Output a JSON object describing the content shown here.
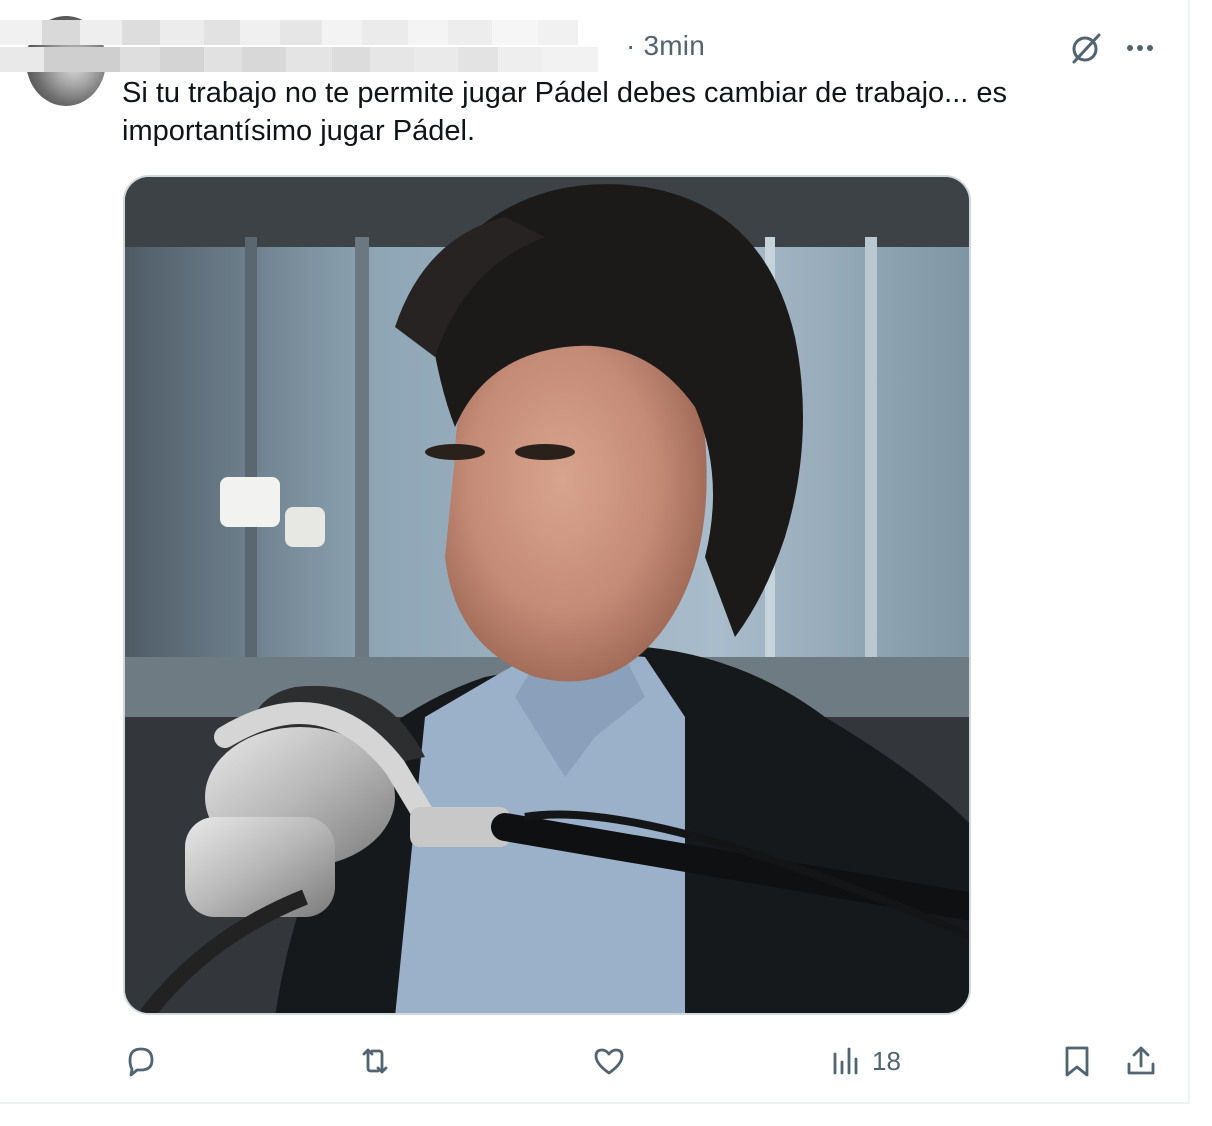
{
  "tweet": {
    "author_blurred": true,
    "time": "· 3min",
    "text": "Si tu trabajo no te permite jugar Pádel debes cambiar de trabajo... es importantísimo jugar Pádel."
  },
  "icons": {
    "grok": "grok-icon",
    "more": "more-dots-icon",
    "reply": "reply-icon",
    "retweet": "retweet-icon",
    "like": "like-icon",
    "views": "views-icon",
    "bookmark": "bookmark-icon",
    "share": "share-icon"
  },
  "actions": {
    "views_count": "18"
  },
  "colors": {
    "text": "#0f1419",
    "muted": "#536471",
    "border": "#cfd9de"
  }
}
